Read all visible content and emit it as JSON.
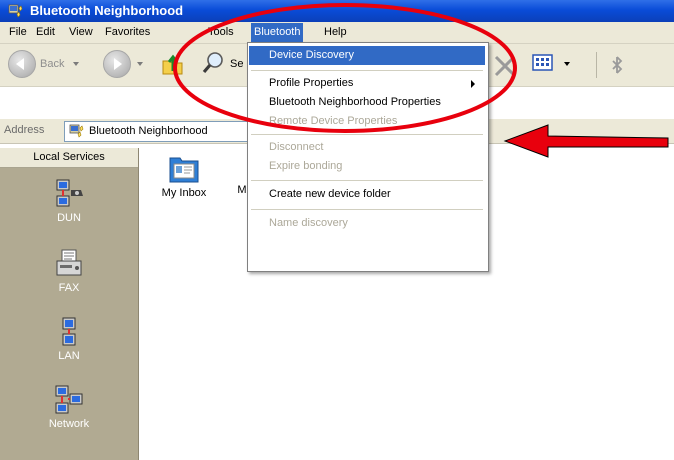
{
  "window": {
    "title": "Bluetooth Neighborhood"
  },
  "menubar": {
    "items": [
      {
        "label": "File"
      },
      {
        "label": "Edit"
      },
      {
        "label": "View"
      },
      {
        "label": "Favorites"
      },
      {
        "label": "Tools"
      },
      {
        "label": "Bluetooth"
      },
      {
        "label": "Help"
      }
    ],
    "open_menu": "Bluetooth"
  },
  "toolbar": {
    "back_label": "Back",
    "search_label": "Se"
  },
  "address": {
    "label": "Address",
    "value": "Bluetooth Neighborhood"
  },
  "bluetooth_menu": {
    "items": [
      {
        "label": "Device Discovery",
        "state": "highlighted"
      },
      {
        "label": "Profile Properties",
        "state": "enabled",
        "submenu": true
      },
      {
        "label": "Bluetooth Neighborhood Properties",
        "state": "enabled"
      },
      {
        "label": "Remote Device Properties",
        "state": "disabled"
      },
      {
        "label": "Disconnect",
        "state": "disabled"
      },
      {
        "label": "Expire bonding",
        "state": "disabled"
      },
      {
        "label": "Create new device folder",
        "state": "enabled"
      },
      {
        "label": "Name discovery",
        "state": "disabled"
      }
    ]
  },
  "left_pane": {
    "header": "Local Services",
    "services": [
      {
        "label": "DUN",
        "icon": "dun-icon"
      },
      {
        "label": "FAX",
        "icon": "fax-icon"
      },
      {
        "label": "LAN",
        "icon": "lan-icon"
      },
      {
        "label": "Network",
        "icon": "network-icon"
      }
    ]
  },
  "content": {
    "items": [
      {
        "label": "My Inbox",
        "icon": "card-inbox-icon"
      },
      {
        "label": "M",
        "icon": "folder-icon"
      }
    ]
  },
  "annotations": {
    "ellipse_color": "#e8000d",
    "arrow_color": "#e8000d"
  },
  "colors": {
    "title_bar": "#0a4cd8",
    "menu_highlight": "#316ac5",
    "left_pane_bg": "#b1aa92",
    "chrome_bg": "#ece9d8"
  }
}
